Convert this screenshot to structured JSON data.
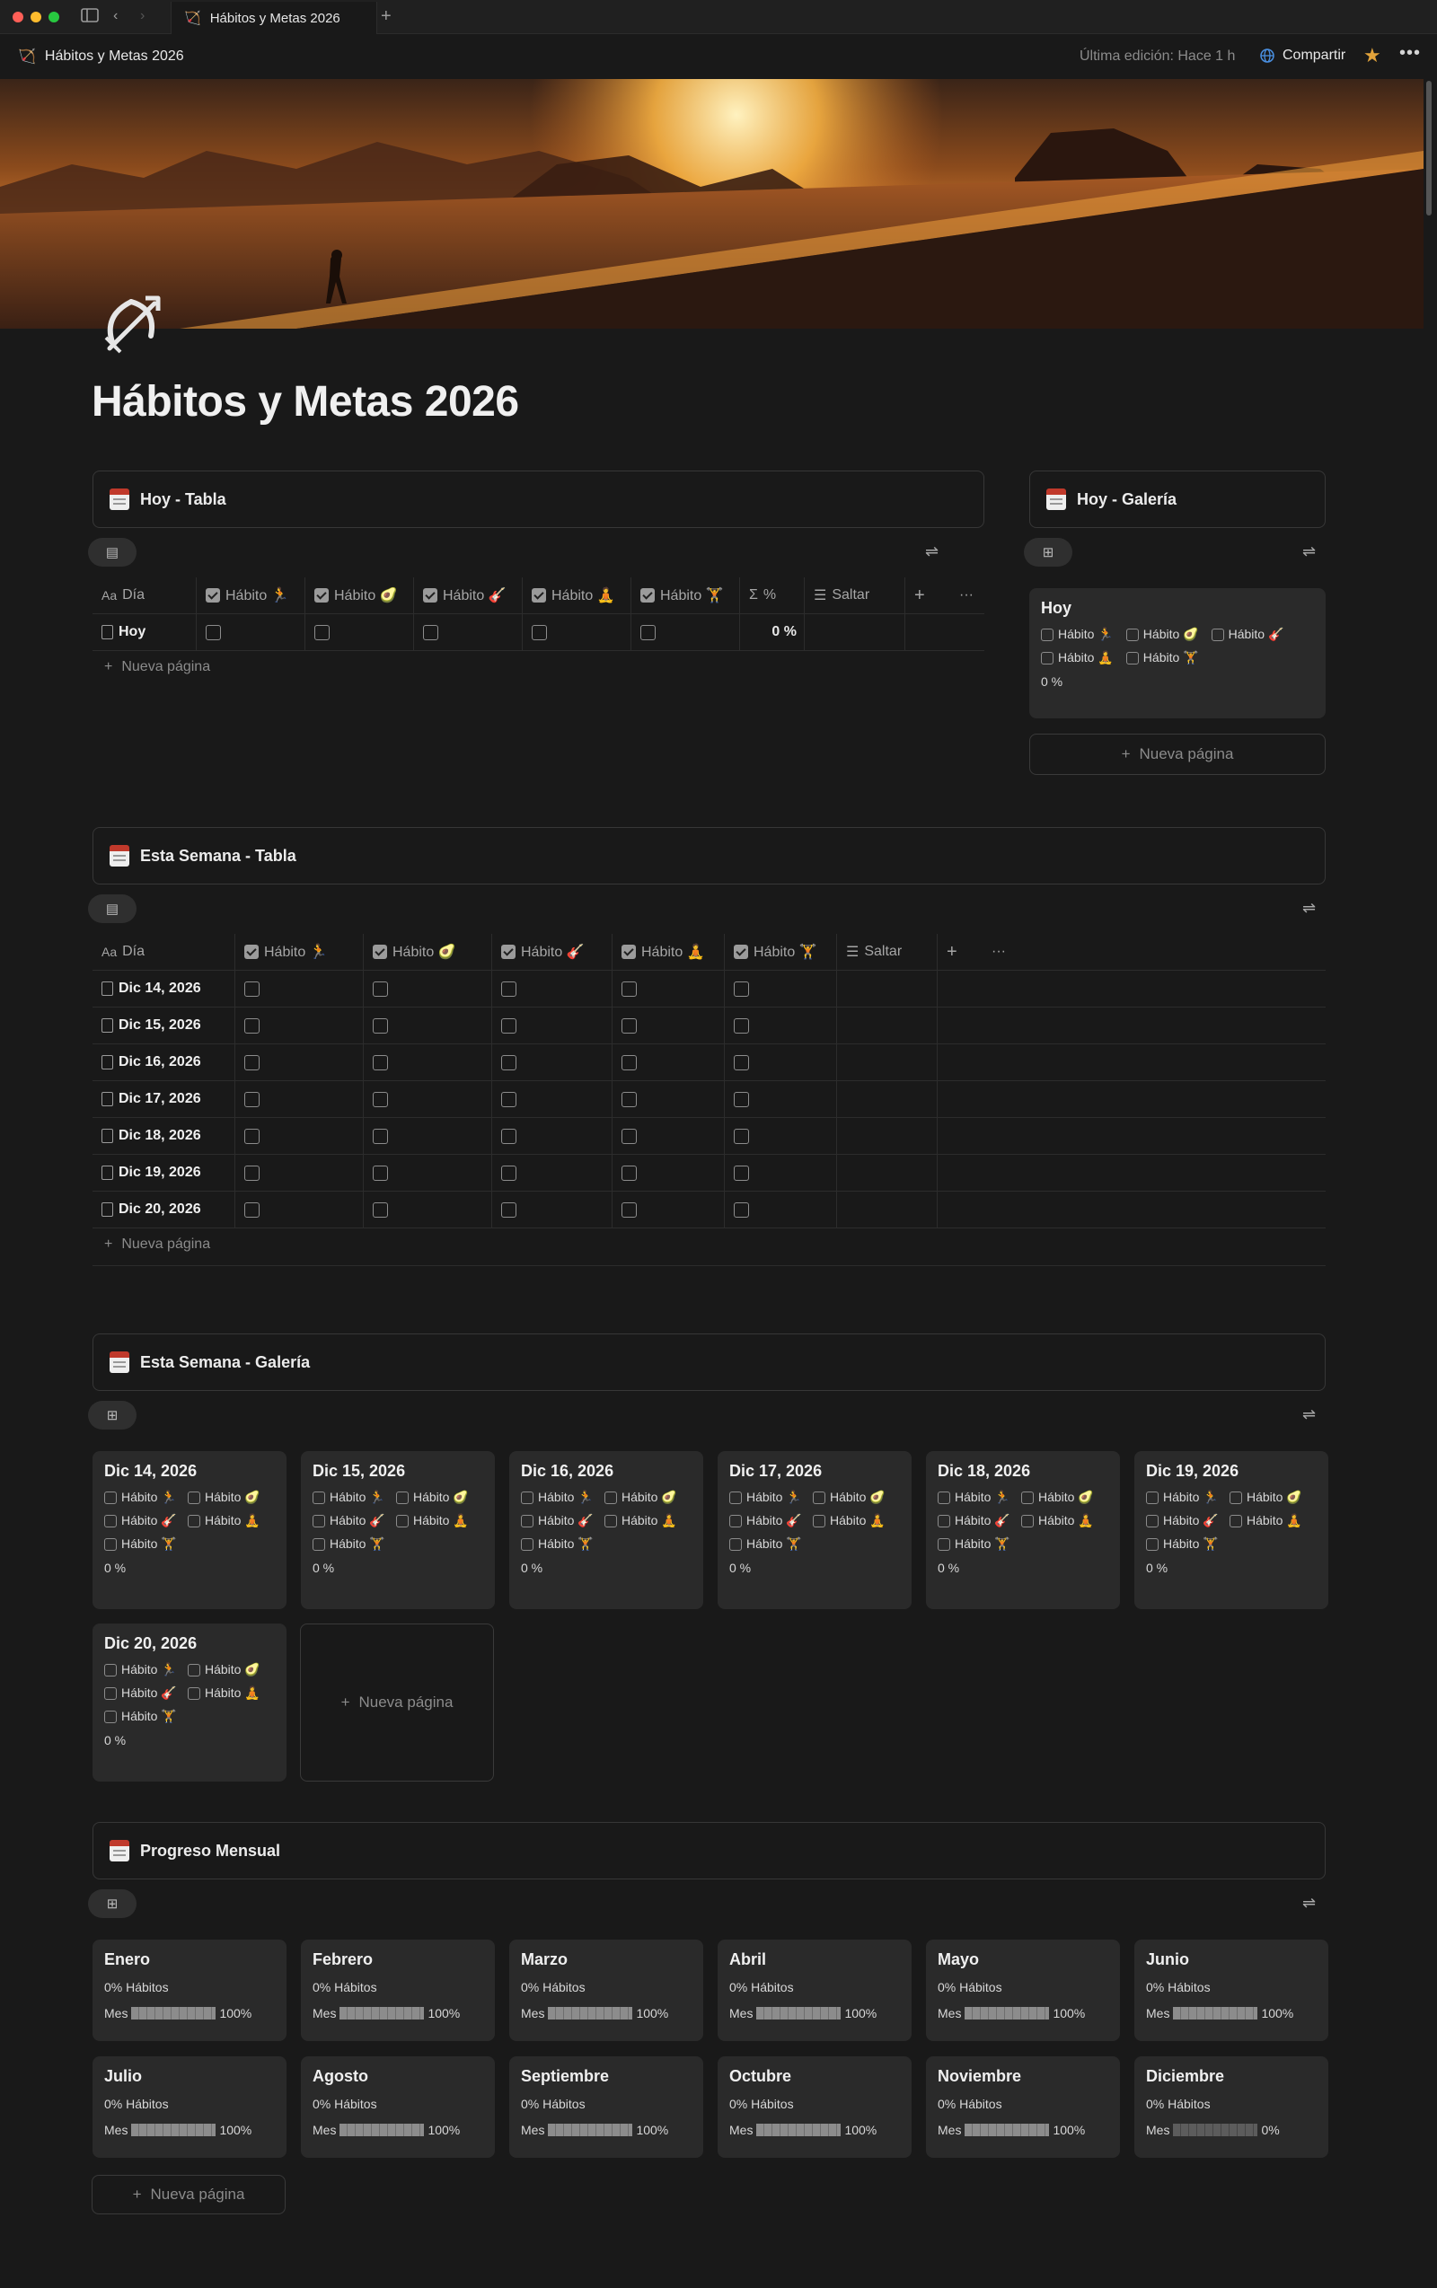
{
  "window": {
    "tab_title": "Hábitos y Metas 2026"
  },
  "topbar": {
    "breadcrumb": "Hábitos y Metas 2026",
    "last_edited": "Última edición: Hace 1 h",
    "share_label": "Compartir"
  },
  "page": {
    "title": "Hábitos y Metas 2026"
  },
  "colors": {
    "accent_star": "#e2a33b",
    "background": "#191919",
    "card": "#2a2a2a"
  },
  "habit_labels": [
    "Hábito 🏃",
    "Hábito 🥑",
    "Hábito 🎸",
    "Hábito 🧘",
    "Hábito 🏋"
  ],
  "today_table": {
    "title": "Hoy - Tabla",
    "headers": {
      "day": "Día",
      "h1": "Hábito 🏃",
      "h2": "Hábito 🥑",
      "h3": "Hábito 🎸",
      "h4": "Hábito 🧘",
      "h5": "Hábito 🏋",
      "pct": "%",
      "skip": "Saltar"
    },
    "row": {
      "day": "Hoy",
      "pct": "0 %"
    },
    "new_page": "Nueva página"
  },
  "today_gallery": {
    "title": "Hoy - Galería",
    "card": {
      "title": "Hoy",
      "h1": "Hábito 🏃",
      "h2": "Hábito 🥑",
      "h3": "Hábito 🎸",
      "h4": "Hábito 🧘",
      "h5": "Hábito 🏋",
      "pct": "0 %"
    },
    "new_page": "Nueva página"
  },
  "week_table": {
    "title": "Esta Semana - Tabla",
    "headers": {
      "day": "Día",
      "h1": "Hábito 🏃",
      "h2": "Hábito 🥑",
      "h3": "Hábito 🎸",
      "h4": "Hábito 🧘",
      "h5": "Hábito 🏋",
      "skip": "Saltar"
    },
    "rows": [
      "Dic 14, 2026",
      "Dic 15, 2026",
      "Dic 16, 2026",
      "Dic 17, 2026",
      "Dic 18, 2026",
      "Dic 19, 2026",
      "Dic 20, 2026"
    ],
    "new_page": "Nueva página"
  },
  "week_gallery": {
    "title": "Esta Semana - Galería",
    "cards": [
      {
        "title": "Dic 14, 2026",
        "pct": "0 %"
      },
      {
        "title": "Dic 15, 2026",
        "pct": "0 %"
      },
      {
        "title": "Dic 16, 2026",
        "pct": "0 %"
      },
      {
        "title": "Dic 17, 2026",
        "pct": "0 %"
      },
      {
        "title": "Dic 18, 2026",
        "pct": "0 %"
      },
      {
        "title": "Dic 19, 2026",
        "pct": "0 %"
      },
      {
        "title": "Dic 20, 2026",
        "pct": "0 %"
      }
    ],
    "new_page": "Nueva página"
  },
  "monthly": {
    "title": "Progreso Mensual",
    "habits_label": "0% Hábitos",
    "month_label": "Mes",
    "months": [
      {
        "name": "Enero",
        "pct": "100%",
        "progress": 1
      },
      {
        "name": "Febrero",
        "pct": "100%",
        "progress": 1
      },
      {
        "name": "Marzo",
        "pct": "100%",
        "progress": 1
      },
      {
        "name": "Abril",
        "pct": "100%",
        "progress": 1
      },
      {
        "name": "Mayo",
        "pct": "100%",
        "progress": 1
      },
      {
        "name": "Junio",
        "pct": "100%",
        "progress": 1
      },
      {
        "name": "Julio",
        "pct": "100%",
        "progress": 1
      },
      {
        "name": "Agosto",
        "pct": "100%",
        "progress": 1
      },
      {
        "name": "Septiembre",
        "pct": "100%",
        "progress": 1
      },
      {
        "name": "Octubre",
        "pct": "100%",
        "progress": 1
      },
      {
        "name": "Noviembre",
        "pct": "100%",
        "progress": 1
      },
      {
        "name": "Diciembre",
        "pct": "0%",
        "progress": 0
      }
    ],
    "new_page": "Nueva página"
  }
}
